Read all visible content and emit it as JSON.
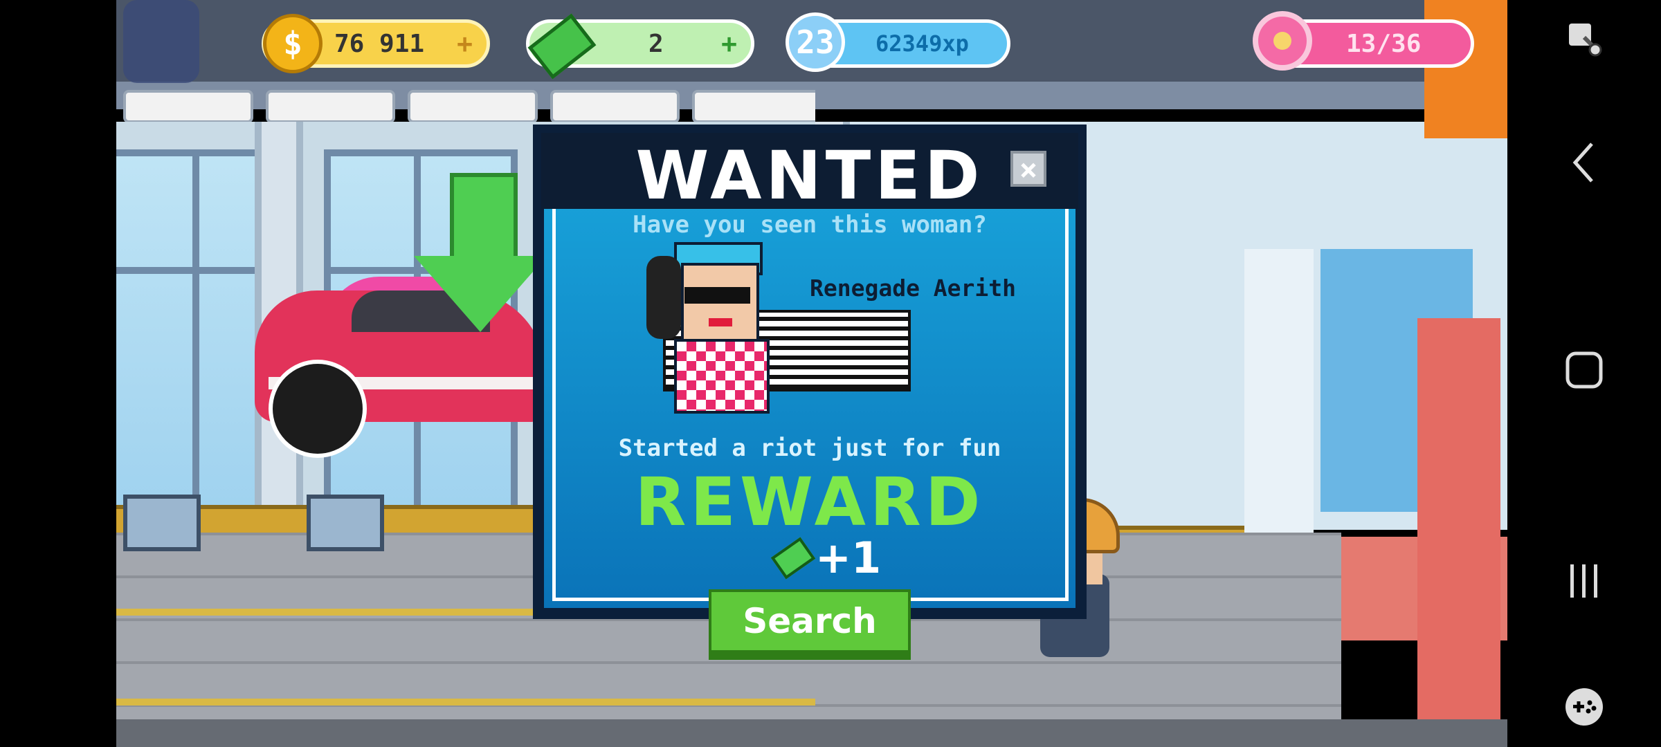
{
  "hud": {
    "coins": "76 911",
    "coins_plus": "+",
    "cash": "2",
    "cash_plus": "+",
    "level": "23",
    "xp": "62349xp",
    "donuts": "13/36",
    "coin_icon": "dollar-coin-icon",
    "cash_icon": "banknote-icon",
    "level_icon": "star-level-icon",
    "donut_icon": "donut-icon"
  },
  "dialog": {
    "title": "WANTED",
    "close": "×",
    "subtitle": "Have you seen this woman?",
    "name": "Renegade Aerith",
    "crime": "Started a riot just for fun",
    "reward_title": "REWARD",
    "reward_amount": "+1",
    "search_label": "Search"
  },
  "nav": {
    "screenshot_icon": "screenshot-edit-icon",
    "back_icon": "back-chevron-icon",
    "home_icon": "home-square-icon",
    "recents_icon": "recents-lines-icon",
    "game_icon": "gamepad-icon"
  },
  "colors": {
    "dialog_bg": "#1aa7dd",
    "reward_green": "#7ee84a",
    "search_green": "#5fc93a",
    "coin_yellow": "#f8d24a",
    "cash_green": "#8fe07e",
    "xp_blue": "#5ec4f3",
    "donut_pink": "#f35b9d"
  }
}
